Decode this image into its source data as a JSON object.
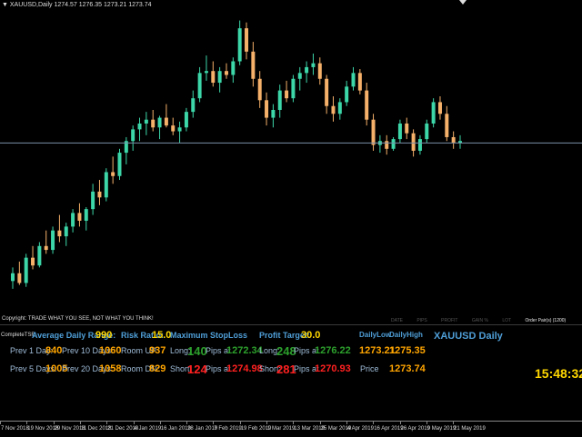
{
  "chart": {
    "title": "▼ XAUUSD,Daily  1274.57 1276.35 1273.21 1273.74",
    "bull_color": "#3cd6a8",
    "bear_color": "#f5b06a",
    "hline_color": "#7a8ea8",
    "hline_price": 1283,
    "price_min": 1200,
    "price_max": 1350,
    "candles": [
      [
        1212,
        1219,
        1208,
        1216
      ],
      [
        1216,
        1222,
        1210,
        1211
      ],
      [
        1211,
        1226,
        1209,
        1224
      ],
      [
        1224,
        1230,
        1218,
        1220
      ],
      [
        1220,
        1232,
        1219,
        1230
      ],
      [
        1230,
        1238,
        1226,
        1228
      ],
      [
        1228,
        1240,
        1226,
        1238
      ],
      [
        1238,
        1246,
        1232,
        1235
      ],
      [
        1235,
        1242,
        1230,
        1240
      ],
      [
        1240,
        1249,
        1237,
        1247
      ],
      [
        1247,
        1252,
        1240,
        1243
      ],
      [
        1243,
        1250,
        1238,
        1249
      ],
      [
        1249,
        1262,
        1246,
        1258
      ],
      [
        1258,
        1264,
        1251,
        1255
      ],
      [
        1255,
        1270,
        1253,
        1268
      ],
      [
        1268,
        1276,
        1262,
        1266
      ],
      [
        1266,
        1280,
        1264,
        1278
      ],
      [
        1278,
        1286,
        1272,
        1284
      ],
      [
        1284,
        1292,
        1279,
        1290
      ],
      [
        1290,
        1296,
        1284,
        1293
      ],
      [
        1293,
        1299,
        1287,
        1295
      ],
      [
        1295,
        1300,
        1289,
        1291
      ],
      [
        1291,
        1297,
        1285,
        1296
      ],
      [
        1296,
        1303,
        1291,
        1292
      ],
      [
        1292,
        1296,
        1287,
        1289
      ],
      [
        1289,
        1294,
        1283,
        1291
      ],
      [
        1291,
        1301,
        1289,
        1299
      ],
      [
        1299,
        1310,
        1296,
        1306
      ],
      [
        1306,
        1322,
        1304,
        1319
      ],
      [
        1319,
        1328,
        1315,
        1320
      ],
      [
        1320,
        1325,
        1312,
        1314
      ],
      [
        1314,
        1322,
        1309,
        1320
      ],
      [
        1320,
        1324,
        1316,
        1318
      ],
      [
        1318,
        1327,
        1314,
        1325
      ],
      [
        1325,
        1346,
        1323,
        1342
      ],
      [
        1342,
        1345,
        1326,
        1330
      ],
      [
        1330,
        1335,
        1312,
        1316
      ],
      [
        1316,
        1320,
        1301,
        1305
      ],
      [
        1305,
        1309,
        1292,
        1296
      ],
      [
        1296,
        1303,
        1291,
        1300
      ],
      [
        1300,
        1313,
        1296,
        1310
      ],
      [
        1310,
        1315,
        1304,
        1306
      ],
      [
        1306,
        1318,
        1304,
        1316
      ],
      [
        1316,
        1322,
        1310,
        1319
      ],
      [
        1319,
        1325,
        1314,
        1322
      ],
      [
        1322,
        1329,
        1318,
        1324
      ],
      [
        1324,
        1327,
        1313,
        1316
      ],
      [
        1316,
        1318,
        1298,
        1302
      ],
      [
        1302,
        1307,
        1294,
        1298
      ],
      [
        1298,
        1306,
        1295,
        1304
      ],
      [
        1304,
        1315,
        1302,
        1312
      ],
      [
        1312,
        1322,
        1310,
        1319
      ],
      [
        1319,
        1321,
        1308,
        1310
      ],
      [
        1310,
        1314,
        1292,
        1295
      ],
      [
        1295,
        1298,
        1279,
        1282
      ],
      [
        1282,
        1287,
        1278,
        1284
      ],
      [
        1284,
        1287,
        1277,
        1280
      ],
      [
        1280,
        1286,
        1279,
        1285
      ],
      [
        1285,
        1295,
        1283,
        1293
      ],
      [
        1293,
        1296,
        1285,
        1288
      ],
      [
        1288,
        1290,
        1276,
        1279
      ],
      [
        1279,
        1287,
        1277,
        1285
      ],
      [
        1285,
        1295,
        1283,
        1293
      ],
      [
        1293,
        1306,
        1291,
        1304
      ],
      [
        1304,
        1307,
        1295,
        1298
      ],
      [
        1298,
        1302,
        1284,
        1286
      ],
      [
        1286,
        1289,
        1280,
        1283
      ],
      [
        1283,
        1287,
        1280,
        1284
      ]
    ]
  },
  "header": {
    "copyright": "Copyright: TRADE WHAT YOU SEE, NOT WHAT YOU THINK!",
    "columns": [
      "DATE",
      "PIPS",
      "PROFIT",
      "GAIN %",
      "LOT"
    ],
    "columns_last": "Order Pair(s) (1200)"
  },
  "panel": {
    "brand": "CompleteTSR",
    "adr_label": "Average Daily Range:",
    "adr_value": "990",
    "prev1_label": "Prev 1 Day:",
    "prev1_value": "840",
    "prev10_label": "Prev 10 Days:",
    "prev10_value": "1060",
    "prev5_label": "Prev 5 Days:",
    "prev5_value": "1005",
    "prev20_label": "Prev 20 Days:",
    "prev20_value": "1058",
    "risk_label": "Risk Ratio:",
    "risk_value": "15.0",
    "room_up_label": "Room UP:",
    "room_up_value": "937",
    "room_dn_label": "Room DN:",
    "room_dn_value": "829",
    "max_sl_label": "Maximum StopLoss",
    "long_label": "Long:",
    "long_value": "140",
    "long_pips_label": "Pips at",
    "long_price": "1272.34",
    "short_label": "Short:",
    "short_value": "124",
    "short_pips_label": "Pips at",
    "short_price": "1274.98",
    "pt_label": "Profit Target:",
    "pt_value": "30.0",
    "pt_long_label": "Long:",
    "pt_long_value": "248",
    "pt_long_pips_label": "Pips at",
    "pt_long_price": "1276.22",
    "pt_short_label": "Short:",
    "pt_short_value": "281",
    "pt_short_pips_label": "Pips at",
    "pt_short_price": "1270.93",
    "daily_low_label": "DailyLow",
    "daily_high_label": "DailyHigh",
    "daily_low_value": "1273.21",
    "daily_high_value": "1275.35",
    "price_label": "Price",
    "price_value": "1273.74",
    "symbol_title": "XAUUSD Daily",
    "clock": "15:48:32"
  },
  "x_axis": {
    "labels": [
      "7 Nov 2018",
      "19 Nov 2018",
      "29 Nov 2018",
      "11 Dec 2018",
      "21 Dec 2018",
      "4 Jan 2019",
      "16 Jan 2019",
      "28 Jan 2019",
      "7 Feb 2019",
      "19 Feb 2019",
      "1 Mar 2019",
      "13 Mar 2019",
      "25 Mar 2019",
      "4 Apr 2019",
      "16 Apr 2019",
      "26 Apr 2019",
      "9 May 2019",
      "21 May 2019"
    ]
  }
}
